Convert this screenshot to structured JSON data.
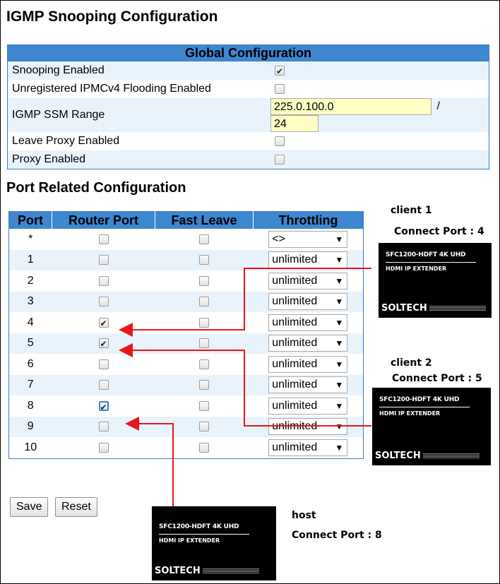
{
  "page_title": "IGMP Snooping Configuration",
  "global": {
    "header": "Global Configuration",
    "rows": [
      {
        "label": "Snooping Enabled",
        "checked": true
      },
      {
        "label": "Unregistered IPMCv4 Flooding Enabled",
        "checked": false
      },
      {
        "label": "IGMP SSM Range",
        "ssm_address": "225.0.100.0",
        "separator": "/",
        "ssm_prefix": "24"
      },
      {
        "label": "Leave Proxy Enabled",
        "checked": false
      },
      {
        "label": "Proxy Enabled",
        "checked": false
      }
    ]
  },
  "ports_section_title": "Port Related Configuration",
  "ports_table": {
    "headers": [
      "Port",
      "Router Port",
      "Fast Leave",
      "Throttling"
    ],
    "rows": [
      {
        "port": "*",
        "router": false,
        "fast_leave": false,
        "throttling": "<>"
      },
      {
        "port": "1",
        "router": false,
        "fast_leave": false,
        "throttling": "unlimited"
      },
      {
        "port": "2",
        "router": false,
        "fast_leave": false,
        "throttling": "unlimited"
      },
      {
        "port": "3",
        "router": false,
        "fast_leave": false,
        "throttling": "unlimited"
      },
      {
        "port": "4",
        "router": true,
        "fast_leave": false,
        "throttling": "unlimited"
      },
      {
        "port": "5",
        "router": true,
        "fast_leave": false,
        "throttling": "unlimited"
      },
      {
        "port": "6",
        "router": false,
        "fast_leave": false,
        "throttling": "unlimited"
      },
      {
        "port": "7",
        "router": false,
        "fast_leave": false,
        "throttling": "unlimited"
      },
      {
        "port": "8",
        "router": true,
        "fast_leave": false,
        "throttling": "unlimited"
      },
      {
        "port": "9",
        "router": false,
        "fast_leave": false,
        "throttling": "unlimited"
      },
      {
        "port": "10",
        "router": false,
        "fast_leave": false,
        "throttling": "unlimited"
      }
    ]
  },
  "buttons": {
    "save": "Save",
    "reset": "Reset"
  },
  "devices": {
    "client1": {
      "name": "client 1",
      "connect": "Connect Port : 4"
    },
    "client2": {
      "name": "client 2",
      "connect": "Connect Port : 5"
    },
    "host": {
      "name": "host",
      "connect": "Connect Port : 8"
    },
    "model": "SFC1200-HDFT  4K UHD",
    "subtitle": "HDMI IP EXTENDER",
    "brand": "SOLTECH"
  },
  "colors": {
    "header_blue": "#3d86d0",
    "row_alt": "#e9f3fc",
    "input_yellow": "#ffffc4",
    "arrow_red": "#e8161b"
  }
}
